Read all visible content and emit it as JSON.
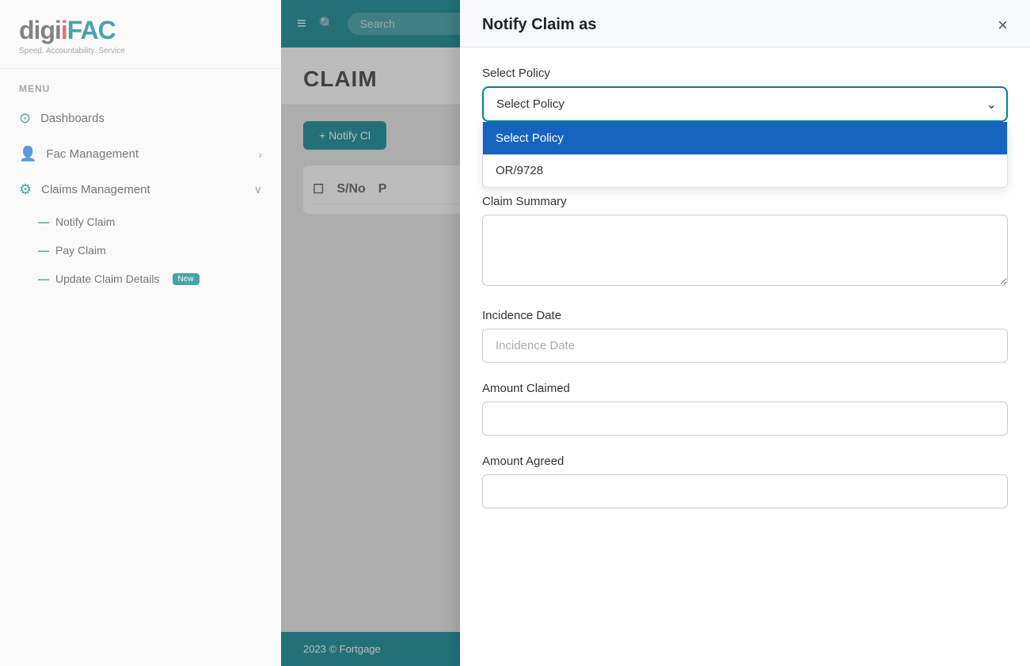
{
  "app": {
    "name": "digiFAC",
    "tagline": "Speed. Accountability. Service"
  },
  "sidebar": {
    "menu_label": "MENU",
    "items": [
      {
        "id": "dashboards",
        "label": "Dashboards",
        "icon": "circle-check",
        "hasArrow": false
      },
      {
        "id": "fac-management",
        "label": "Fac Management",
        "icon": "person-circle",
        "hasArrow": true
      },
      {
        "id": "claims-management",
        "label": "Claims Management",
        "icon": "grid",
        "hasArrow": true
      }
    ],
    "sub_items": [
      {
        "id": "notify-claim",
        "label": "Notify Claim",
        "badge": null
      },
      {
        "id": "pay-claim",
        "label": "Pay Claim",
        "badge": null
      },
      {
        "id": "update-claim-details",
        "label": "Update Claim Details",
        "badge": "New"
      }
    ]
  },
  "main": {
    "topbar": {
      "search_placeholder": "Search"
    },
    "page_title": "CLAIM",
    "notify_btn_label": "+ Notify Cl",
    "table": {
      "checkbox_col": "",
      "sno_col": "S/No",
      "p_col": "P"
    },
    "footer": "2023 © Fortgage"
  },
  "modal": {
    "title": "Notify Claim as",
    "close_label": "×",
    "sections": [
      {
        "id": "select-policy",
        "label": "Select Policy",
        "type": "select",
        "placeholder": "Select Policy",
        "options": [
          {
            "value": "",
            "label": "Select Policy",
            "selected": true
          },
          {
            "value": "OR/9728",
            "label": "OR/9728"
          }
        ]
      },
      {
        "id": "claim-summary",
        "label": "Claim Summary",
        "type": "textarea",
        "placeholder": ""
      },
      {
        "id": "incidence-date",
        "label": "Incidence Date",
        "type": "input",
        "placeholder": "Incidence Date"
      },
      {
        "id": "amount-claimed",
        "label": "Amount Claimed",
        "type": "input",
        "placeholder": ""
      },
      {
        "id": "amount-agreed",
        "label": "Amount Agreed",
        "type": "input",
        "placeholder": ""
      }
    ],
    "dropdown": {
      "is_open": true,
      "options": [
        {
          "label": "Select Policy",
          "selected": true
        },
        {
          "label": "OR/9728",
          "selected": false
        }
      ]
    }
  }
}
